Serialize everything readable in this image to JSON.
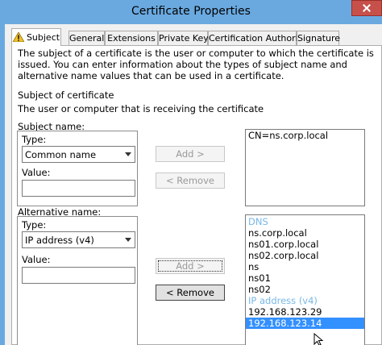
{
  "window": {
    "title": "Certificate Properties"
  },
  "tabs": [
    {
      "label": "Subject",
      "active": true,
      "icon": "warning-icon"
    },
    {
      "label": "General"
    },
    {
      "label": "Extensions"
    },
    {
      "label": "Private Key"
    },
    {
      "label": "Certification Authority"
    },
    {
      "label": "Signature"
    }
  ],
  "subject_page": {
    "description": "The subject of a certificate is the user or computer to which the certificate is issued. You can enter information about the types of subject name and alternative name values that can be used in a certificate.",
    "section_title": "Subject of certificate",
    "section_subtitle": "The user or computer that is receiving the certificate",
    "subject_name": {
      "label": "Subject name:",
      "type_label": "Type:",
      "type_value": "Common name",
      "value_label": "Value:",
      "value": ""
    },
    "alternative_name": {
      "label": "Alternative name:",
      "type_label": "Type:",
      "type_value": "IP address (v4)",
      "value_label": "Value:",
      "value": ""
    },
    "buttons": {
      "add_subject": "Add >",
      "remove_subject": "< Remove",
      "add_alt": "Add >",
      "remove_alt": "< Remove"
    },
    "subject_list": [
      "CN=ns.corp.local"
    ],
    "alt_list": [
      {
        "text": "DNS",
        "header": true
      },
      {
        "text": "ns.corp.local"
      },
      {
        "text": "ns01.corp.local"
      },
      {
        "text": "ns02.corp.local"
      },
      {
        "text": "ns"
      },
      {
        "text": "ns01"
      },
      {
        "text": "ns02"
      },
      {
        "text": "IP address (v4)",
        "header": true
      },
      {
        "text": "192.168.123.29"
      },
      {
        "text": "192.168.123.14",
        "selected": true
      }
    ]
  },
  "colors": {
    "title_bar": "#6aa9e0",
    "close_button": "#c7504b",
    "selection": "#3390ff",
    "list_header": "#77b8e6"
  }
}
